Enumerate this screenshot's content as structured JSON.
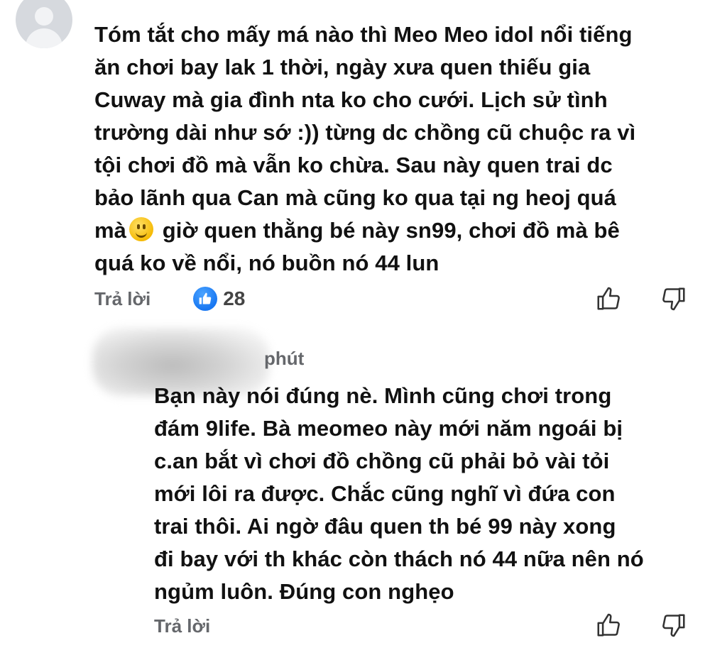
{
  "comment1": {
    "text": "Tóm tắt cho mấy má nào thì Meo Meo idol nổi tiếng\năn chơi bay lak 1 thời, ngày xưa quen thiếu gia\nCuway mà gia đình nta ko cho cưới. Lịch sử tình\ntrường dài như sớ :)) từng dc chồng cũ chuộc ra vì\ntội chơi đồ mà vẫn ko chừa. Sau này quen trai dc\nbảo lãnh qua Can mà cũng ko qua tại ng heoj quá\nmà",
    "text_after_emoji": " giờ quen thằng bé này sn99, chơi đồ mà bê\nquá ko về nổi, nó buồn nó 44 lun",
    "emoji": "slightly-smiling-face",
    "reply_label": "Trả lời",
    "like_count": "28"
  },
  "comment2": {
    "time": "phút",
    "text": "Bạn này nói đúng nè. Mình cũng chơi trong\nđám 9life. Bà meomeo này mới năm ngoái bị\nc.an bắt vì chơi đồ chồng cũ phải bỏ vài tỏi\nmới lôi ra được. Chắc cũng nghĩ vì đứa con\ntrai thôi. Ai ngờ đâu quen th bé 99 này xong\nđi bay với th khác còn thách nó 44 nữa nên nó\nngủm luôn. Đúng con nghẹo",
    "reply_label": "Trả lời"
  },
  "colors": {
    "text": "#111111",
    "secondary": "#65676b",
    "like_blue": "#1877f2"
  }
}
